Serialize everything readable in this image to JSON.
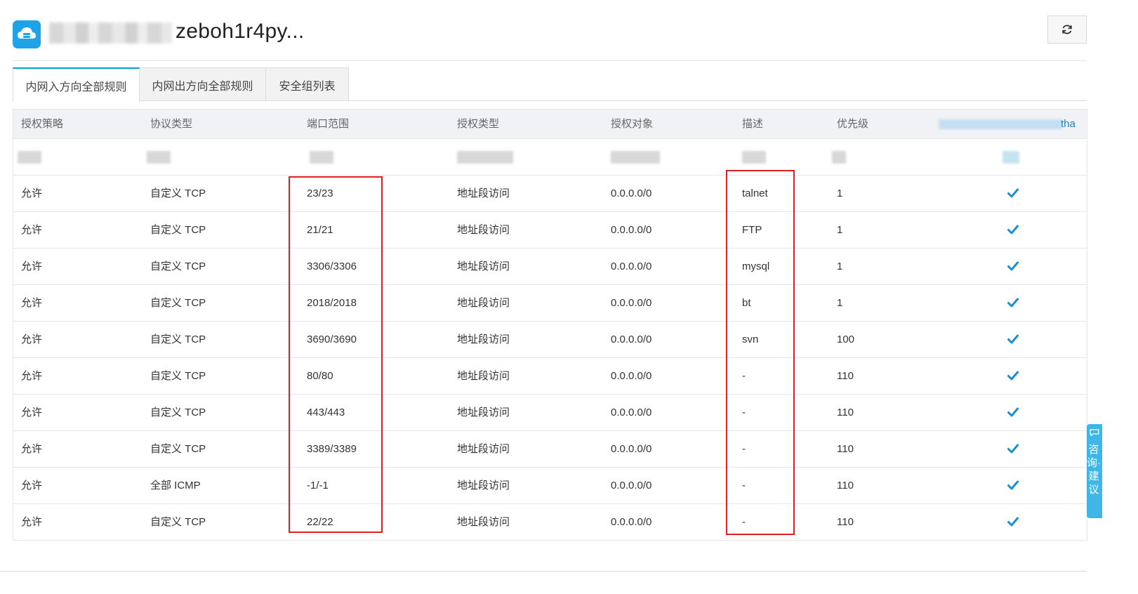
{
  "header": {
    "title": "zeboh1r4py..."
  },
  "tabs": [
    {
      "label": "内网入方向全部规则",
      "active": true
    },
    {
      "label": "内网出方向全部规则",
      "active": false
    },
    {
      "label": "安全组列表",
      "active": false
    }
  ],
  "table": {
    "columns": [
      "授权策略",
      "协议类型",
      "端口范围",
      "授权类型",
      "授权对象",
      "描述",
      "优先级"
    ],
    "last_column_fragment": "tha",
    "rows": [
      {
        "policy": "允许",
        "protocol": "自定义 TCP",
        "port": "23/23",
        "auth_type": "地址段访问",
        "object": "0.0.0.0/0",
        "desc": "talnet",
        "priority": "1"
      },
      {
        "policy": "允许",
        "protocol": "自定义 TCP",
        "port": "21/21",
        "auth_type": "地址段访问",
        "object": "0.0.0.0/0",
        "desc": "FTP",
        "priority": "1"
      },
      {
        "policy": "允许",
        "protocol": "自定义 TCP",
        "port": "3306/3306",
        "auth_type": "地址段访问",
        "object": "0.0.0.0/0",
        "desc": "mysql",
        "priority": "1"
      },
      {
        "policy": "允许",
        "protocol": "自定义 TCP",
        "port": "2018/2018",
        "auth_type": "地址段访问",
        "object": "0.0.0.0/0",
        "desc": "bt",
        "priority": "1"
      },
      {
        "policy": "允许",
        "protocol": "自定义 TCP",
        "port": "3690/3690",
        "auth_type": "地址段访问",
        "object": "0.0.0.0/0",
        "desc": "svn",
        "priority": "100"
      },
      {
        "policy": "允许",
        "protocol": "自定义 TCP",
        "port": "80/80",
        "auth_type": "地址段访问",
        "object": "0.0.0.0/0",
        "desc": "-",
        "priority": "110"
      },
      {
        "policy": "允许",
        "protocol": "自定义 TCP",
        "port": "443/443",
        "auth_type": "地址段访问",
        "object": "0.0.0.0/0",
        "desc": "-",
        "priority": "110"
      },
      {
        "policy": "允许",
        "protocol": "自定义 TCP",
        "port": "3389/3389",
        "auth_type": "地址段访问",
        "object": "0.0.0.0/0",
        "desc": "-",
        "priority": "110"
      },
      {
        "policy": "允许",
        "protocol": "全部 ICMP",
        "port": "-1/-1",
        "auth_type": "地址段访问",
        "object": "0.0.0.0/0",
        "desc": "-",
        "priority": "110"
      },
      {
        "policy": "允许",
        "protocol": "自定义 TCP",
        "port": "22/22",
        "auth_type": "地址段访问",
        "object": "0.0.0.0/0",
        "desc": "-",
        "priority": "110"
      }
    ]
  },
  "feedback": {
    "label": "咨询·建议"
  },
  "colors": {
    "accent": "#00a2ca",
    "check": "#1a8fd6",
    "highlight": "#e02020",
    "app_icon": "#1ea3e8"
  },
  "icons": {
    "app": "cloud-server-icon",
    "refresh": "refresh-icon",
    "check": "check-icon",
    "feedback": "chat-icon"
  }
}
